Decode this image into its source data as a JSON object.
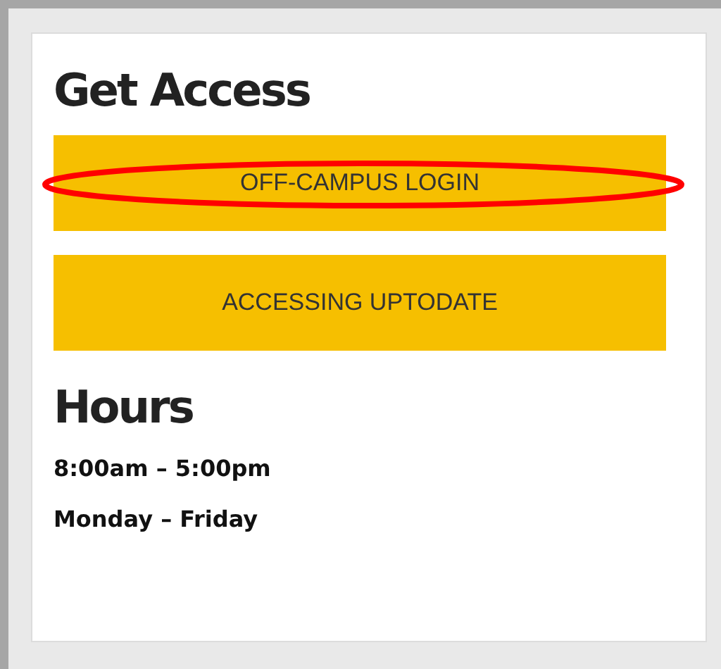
{
  "sections": [
    {
      "heading": "Get Access",
      "buttons": [
        {
          "label": "OFF-CAMPUS LOGIN",
          "highlighted": true
        },
        {
          "label": "ACCESSING UPTODATE",
          "highlighted": false
        }
      ]
    },
    {
      "heading": "Hours",
      "lines": [
        "8:00am – 5:00pm",
        "Monday – Friday"
      ]
    }
  ]
}
